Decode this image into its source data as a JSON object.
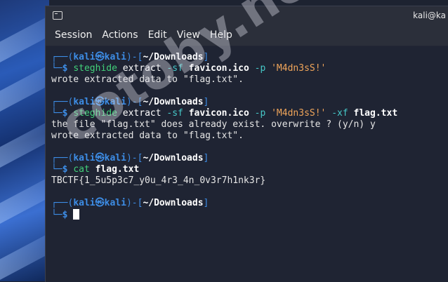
{
  "window": {
    "title": "kali@ka"
  },
  "menu": [
    "Session",
    "Actions",
    "Edit",
    "View",
    "Help"
  ],
  "prompt": {
    "user": "kali",
    "at": "㉿",
    "host": "kali",
    "dir": "~/Downloads"
  },
  "commands": [
    {
      "cmd": "steghide",
      "args": [
        {
          "t": " extract ",
          "c": "white"
        },
        {
          "t": "-sf",
          "c": "flag"
        },
        {
          "t": " ",
          "c": "white"
        },
        {
          "t": "favicon.ico",
          "c": "bold"
        },
        {
          "t": " ",
          "c": "white"
        },
        {
          "t": "-p",
          "c": "flag"
        },
        {
          "t": " ",
          "c": "white"
        },
        {
          "t": "'M4dn3sS!'",
          "c": "str"
        }
      ],
      "output": [
        "wrote extracted data to \"flag.txt\"."
      ]
    },
    {
      "cmd": "steghide",
      "args": [
        {
          "t": " extract ",
          "c": "white"
        },
        {
          "t": "-sf",
          "c": "flag"
        },
        {
          "t": " ",
          "c": "white"
        },
        {
          "t": "favicon.ico",
          "c": "bold"
        },
        {
          "t": " ",
          "c": "white"
        },
        {
          "t": "-p",
          "c": "flag"
        },
        {
          "t": " ",
          "c": "white"
        },
        {
          "t": "'M4dn3sS!'",
          "c": "str"
        },
        {
          "t": " ",
          "c": "white"
        },
        {
          "t": "-xf",
          "c": "flag"
        },
        {
          "t": " ",
          "c": "white"
        },
        {
          "t": "flag.txt",
          "c": "bold"
        }
      ],
      "output": [
        "the file \"flag.txt\" does already exist. overwrite ? (y/n) y",
        "wrote extracted data to \"flag.txt\"."
      ]
    },
    {
      "cmd": "cat",
      "args": [
        {
          "t": " ",
          "c": "white"
        },
        {
          "t": "flag.txt",
          "c": "bold"
        }
      ],
      "output": [
        "TBCTF{1_5u5p3c7_y0u_4r3_4n_0v3r7h1nk3r}"
      ]
    }
  ],
  "watermark": "cotoby.net",
  "colors": {
    "prompt_blue": "#3d8de6",
    "command_green": "#42d17a",
    "option_cyan": "#46c9c9",
    "string_orange": "#f0a55a"
  }
}
